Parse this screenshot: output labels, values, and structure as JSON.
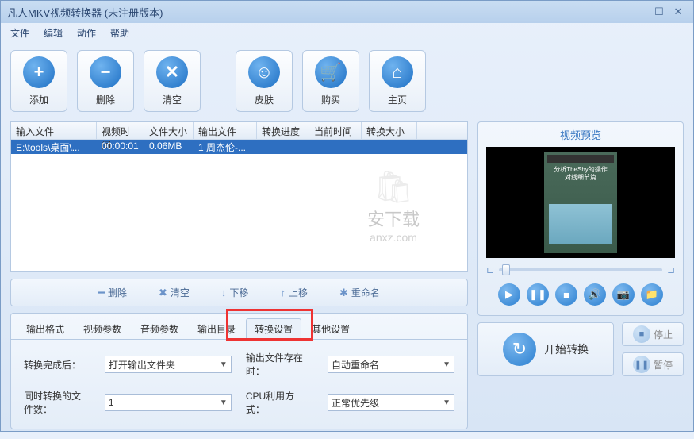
{
  "window": {
    "title": "凡人MKV视频转换器    (未注册版本)"
  },
  "menu": {
    "file": "文件",
    "edit": "编辑",
    "action": "动作",
    "help": "帮助"
  },
  "toolbar": {
    "add": "添加",
    "delete": "删除",
    "clear": "清空",
    "skin": "皮肤",
    "buy": "购买",
    "home": "主页"
  },
  "table": {
    "headers": {
      "input": "输入文件",
      "time": "视频时间",
      "size": "文件大小",
      "output": "输出文件",
      "progress": "转换进度",
      "current": "当前时间",
      "outsize": "转换大小"
    },
    "rows": [
      {
        "input": "E:\\tools\\桌面\\...",
        "time": "00:00:01",
        "size": "0.06MB",
        "output": "1 周杰伦-...",
        "progress": "",
        "current": "",
        "outsize": ""
      }
    ]
  },
  "watermark": {
    "text": "安下载",
    "url": "anxz.com"
  },
  "listbar": {
    "delete": "删除",
    "clear": "清空",
    "down": "下移",
    "up": "上移",
    "rename": "重命名"
  },
  "tabs": {
    "output": "输出格式",
    "video": "视频参数",
    "audio": "音频参数",
    "outdir": "输出目录",
    "convert": "转换设置",
    "other": "其他设置"
  },
  "settings": {
    "after_label": "转换完成后：",
    "after_value": "打开输出文件夹",
    "exist_label": "输出文件存在时：",
    "exist_value": "自动重命名",
    "concurrent_label": "同时转换的文件数：",
    "concurrent_value": "1",
    "cpu_label": "CPU利用方式：",
    "cpu_value": "正常优先级"
  },
  "preview": {
    "title": "视频预览",
    "caption1": "分析TheShy的操作",
    "caption2": "对线细节篇"
  },
  "actions": {
    "start": "开始转换",
    "stop": "停止",
    "pause": "暂停"
  }
}
